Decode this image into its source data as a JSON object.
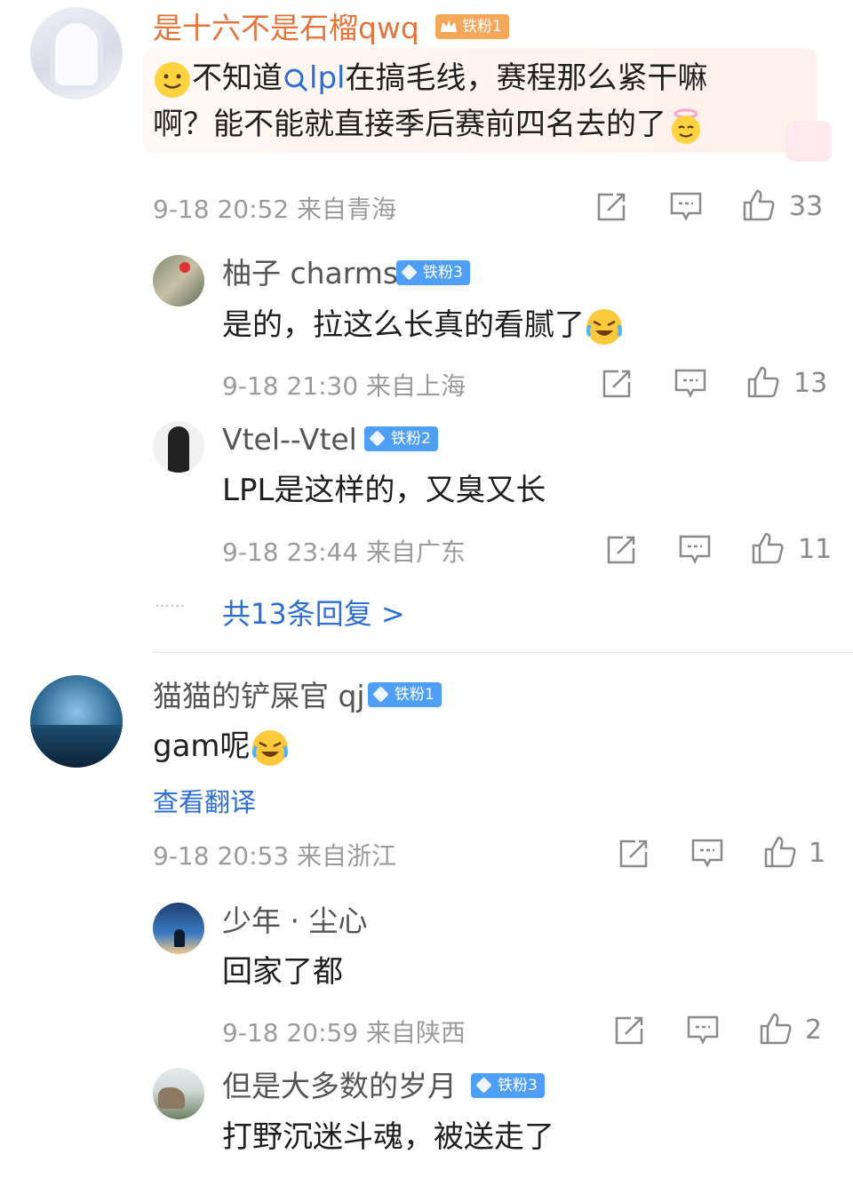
{
  "comments": [
    {
      "name": "是十六不是石榴qwq",
      "badge": "铁粉1",
      "text_parts": [
        "不知道",
        "lpl",
        "在搞毛线，赛程那么紧干嘛",
        "啊？能不能就直接季后赛前四名去的了"
      ],
      "meta": "9-18 20:52  来自青海",
      "likes": "33"
    },
    {
      "name": "柚子 charms",
      "badge": "铁粉3",
      "text": "是的，拉这么长真的看腻了",
      "meta": "9-18 21:30  来自上海",
      "likes": "13"
    },
    {
      "name": "Vtel--Vtel",
      "badge": "铁粉2",
      "text": "LPL是这样的，又臭又长",
      "meta": "9-18 23:44  来自广东",
      "likes": "11"
    },
    {
      "replies_link": "共13条回复 >",
      "dots": "······"
    },
    {
      "name": "猫猫的铲屎官 qj",
      "badge": "铁粉1",
      "text": "gam呢",
      "translate": "查看翻译",
      "meta": "9-18 20:53  来自浙江",
      "likes": "1"
    },
    {
      "name": "少年 · 尘心",
      "text": "回家了都",
      "meta": "9-18 20:59  来自陕西",
      "likes": "2"
    },
    {
      "name": "但是大多数的岁月",
      "badge": "铁粉3",
      "text": "打野沉迷斗魂，被送走了"
    }
  ],
  "colors": {
    "vip_name": "#e5743b",
    "badge_blue": "#4f9ff7",
    "badge_gold": "#f5a85a",
    "link": "#2d6ed1"
  },
  "icons": [
    "repost-icon",
    "comment-icon",
    "like-icon",
    "search-icon",
    "smile-emoji",
    "laugh-cry-emoji",
    "angel-emoji",
    "crown-icon"
  ]
}
